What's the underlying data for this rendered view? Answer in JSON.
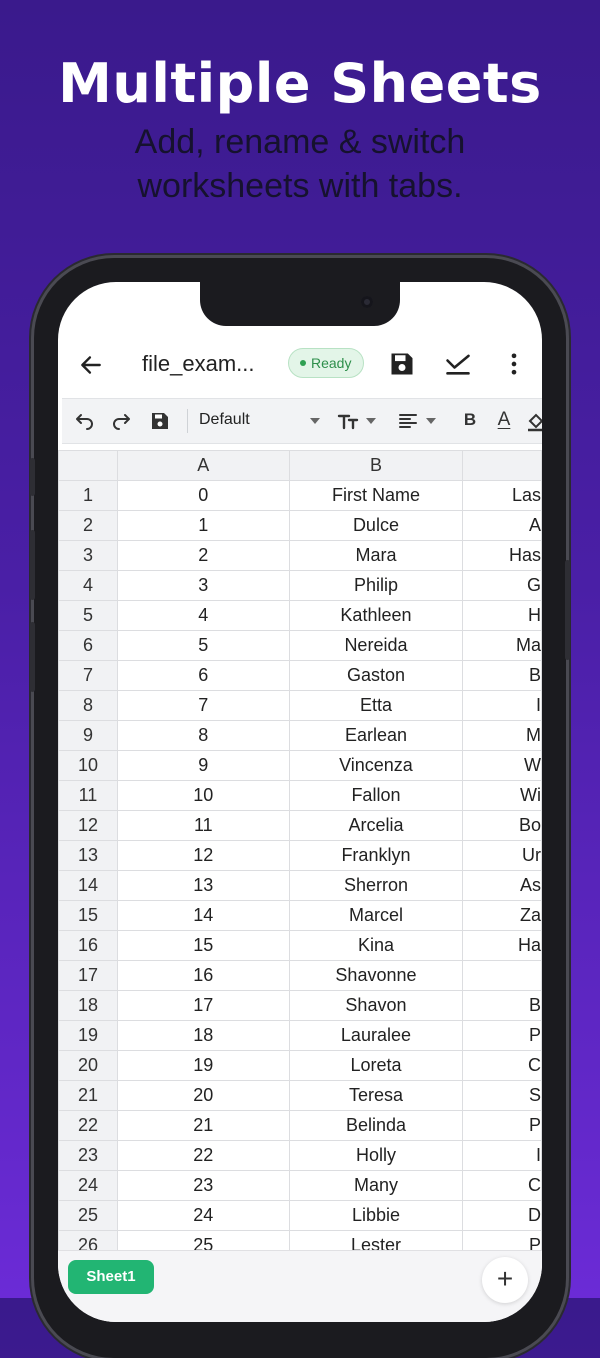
{
  "promo": {
    "headline": "Multiple Sheets",
    "subline_1": "Add, rename & switch",
    "subline_2": "worksheets with tabs."
  },
  "appbar": {
    "back_icon": "arrow-left-icon",
    "file_title": "file_exam...",
    "status_badge": "Ready",
    "status_color": "#2e8f4b",
    "save_icon": "floppy-disk-icon",
    "export_icon": "check-download-icon",
    "menu_icon": "more-vertical-icon"
  },
  "toolbar": {
    "undo_icon": "undo-icon",
    "redo_icon": "redo-icon",
    "save_icon": "floppy-disk-icon",
    "font_name": "Default",
    "text_size_icon": "text-size-icon",
    "align_icon": "align-left-icon",
    "bold_label": "B",
    "text_color_label": "A",
    "fill_icon": "paint-bucket-icon"
  },
  "grid": {
    "columns": [
      "A",
      "B",
      ""
    ],
    "rows": [
      {
        "num": "1",
        "a": "0",
        "b": "First Name",
        "c": "Las"
      },
      {
        "num": "2",
        "a": "1",
        "b": "Dulce",
        "c": "A"
      },
      {
        "num": "3",
        "a": "2",
        "b": "Mara",
        "c": "Has"
      },
      {
        "num": "4",
        "a": "3",
        "b": "Philip",
        "c": "G"
      },
      {
        "num": "5",
        "a": "4",
        "b": "Kathleen",
        "c": "H"
      },
      {
        "num": "6",
        "a": "5",
        "b": "Nereida",
        "c": "Ma"
      },
      {
        "num": "7",
        "a": "6",
        "b": "Gaston",
        "c": "B"
      },
      {
        "num": "8",
        "a": "7",
        "b": "Etta",
        "c": "I"
      },
      {
        "num": "9",
        "a": "8",
        "b": "Earlean",
        "c": "M"
      },
      {
        "num": "10",
        "a": "9",
        "b": "Vincenza",
        "c": "W"
      },
      {
        "num": "11",
        "a": "10",
        "b": "Fallon",
        "c": "Wi"
      },
      {
        "num": "12",
        "a": "11",
        "b": "Arcelia",
        "c": "Bo"
      },
      {
        "num": "13",
        "a": "12",
        "b": "Franklyn",
        "c": "Ur"
      },
      {
        "num": "14",
        "a": "13",
        "b": "Sherron",
        "c": "As"
      },
      {
        "num": "15",
        "a": "14",
        "b": "Marcel",
        "c": "Za"
      },
      {
        "num": "16",
        "a": "15",
        "b": "Kina",
        "c": "Ha"
      },
      {
        "num": "17",
        "a": "16",
        "b": "Shavonne",
        "c": ""
      },
      {
        "num": "18",
        "a": "17",
        "b": "Shavon",
        "c": "B"
      },
      {
        "num": "19",
        "a": "18",
        "b": "Lauralee",
        "c": "P"
      },
      {
        "num": "20",
        "a": "19",
        "b": "Loreta",
        "c": "C"
      },
      {
        "num": "21",
        "a": "20",
        "b": "Teresa",
        "c": "S"
      },
      {
        "num": "22",
        "a": "21",
        "b": "Belinda",
        "c": "P"
      },
      {
        "num": "23",
        "a": "22",
        "b": "Holly",
        "c": "I"
      },
      {
        "num": "24",
        "a": "23",
        "b": "Many",
        "c": "C"
      },
      {
        "num": "25",
        "a": "24",
        "b": "Libbie",
        "c": "D"
      },
      {
        "num": "26",
        "a": "25",
        "b": "Lester",
        "c": "P"
      }
    ]
  },
  "sheets": {
    "tabs": [
      "Sheet1"
    ],
    "active_color": "#22b573",
    "add_label": "+"
  }
}
